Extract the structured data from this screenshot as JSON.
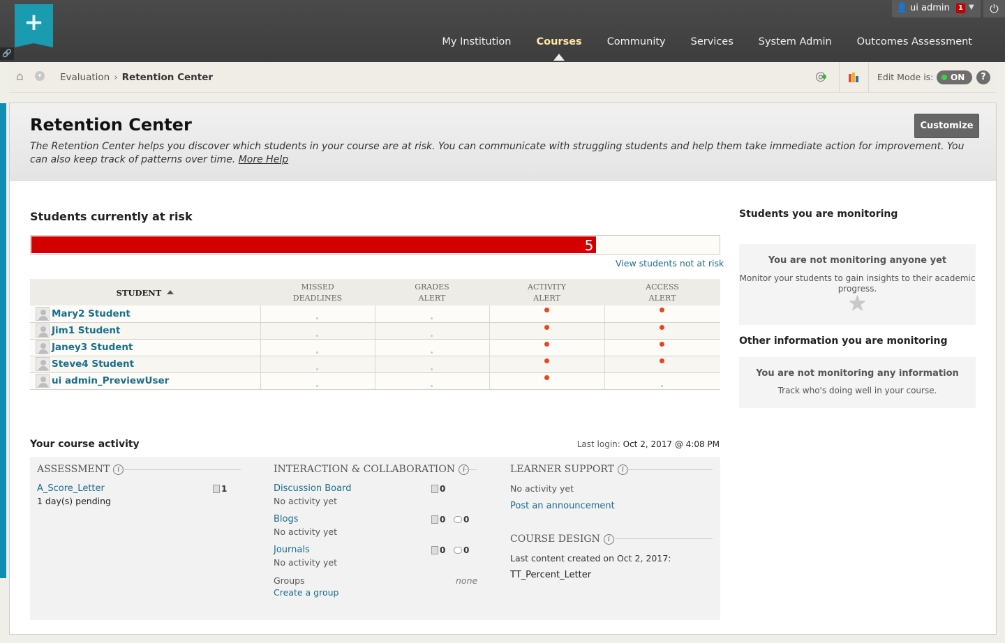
{
  "header": {
    "logo_icon": "plus-icon",
    "user_name": "ui admin",
    "notification_count": "1",
    "nav": [
      {
        "label": "My Institution",
        "active": false
      },
      {
        "label": "Courses",
        "active": true
      },
      {
        "label": "Community",
        "active": false
      },
      {
        "label": "Services",
        "active": false
      },
      {
        "label": "System Admin",
        "active": false
      },
      {
        "label": "Outcomes Assessment",
        "active": false
      }
    ]
  },
  "breadcrumb": {
    "items": [
      "Evaluation"
    ],
    "current": "Retention Center",
    "edit_mode_label": "Edit Mode is:",
    "edit_mode_value": "ON",
    "help": "?"
  },
  "page": {
    "title": "Retention Center",
    "description": "The Retention Center helps you discover which students in your course are at risk. You can communicate with struggling students and help them take immediate action for improvement. You can also keep track of patterns over time.",
    "more_help": "More Help",
    "customize_label": "Customize"
  },
  "at_risk": {
    "heading": "Students currently at risk",
    "count": "5",
    "fill_fraction": 0.82,
    "view_not_at_risk": "View students not at risk",
    "columns": {
      "student": "STUDENT",
      "missed_1": "MISSED",
      "missed_2": "DEADLINES",
      "grades_1": "GRADES",
      "grades_2": "ALERT",
      "activity_1": "ACTIVITY",
      "activity_2": "ALERT",
      "access_1": "ACCESS",
      "access_2": "ALERT"
    },
    "rows": [
      {
        "name": "Mary2 Student",
        "missed": false,
        "grades": false,
        "activity": true,
        "access": true
      },
      {
        "name": "Jim1 Student",
        "missed": false,
        "grades": false,
        "activity": true,
        "access": true
      },
      {
        "name": "Janey3 Student",
        "missed": false,
        "grades": false,
        "activity": true,
        "access": true
      },
      {
        "name": "Steve4 Student",
        "missed": false,
        "grades": false,
        "activity": true,
        "access": true
      },
      {
        "name": "ui admin_PreviewUser",
        "missed": false,
        "grades": false,
        "activity": true,
        "access": false
      }
    ],
    "alert_color": "#e8461d"
  },
  "monitoring": {
    "heading": "Students you are monitoring",
    "empty_title": "You are not monitoring anyone yet",
    "empty_text": "Monitor your students to gain insights to their academic progress.",
    "other_heading": "Other information you are monitoring",
    "other_empty_title": "You are not monitoring any information",
    "other_empty_text": "Track who's doing well in your course."
  },
  "activity": {
    "heading": "Your course activity",
    "last_login_label": "Last login:",
    "last_login_value": "Oct 2, 2017 @ 4:08 PM",
    "assessment": {
      "heading": "ASSESSMENT",
      "item_label": "A_Score_Letter",
      "item_status": "1 day(s) pending",
      "item_count": "1"
    },
    "interaction": {
      "heading": "INTERACTION & COLLABORATION",
      "discussion_label": "Discussion Board",
      "discussion_status": "No activity yet",
      "discussion_count": "0",
      "blogs_label": "Blogs",
      "blogs_status": "No activity yet",
      "blogs_count": "0",
      "blogs_comments": "0",
      "journals_label": "Journals",
      "journals_status": "No activity yet",
      "journals_count": "0",
      "journals_comments": "0",
      "groups_label": "Groups",
      "groups_value": "none",
      "create_group": "Create a group"
    },
    "learner_support": {
      "heading": "LEARNER SUPPORT",
      "status": "No activity yet",
      "post_announcement": "Post an announcement"
    },
    "course_design": {
      "heading": "COURSE DESIGN",
      "last_content": "Last content created on Oct 2, 2017:",
      "content_name": "TT_Percent_Letter"
    }
  },
  "colors": {
    "accent": "#1a6e8a",
    "risk_bar": "#d40000",
    "logo": "#1a9bb0"
  }
}
